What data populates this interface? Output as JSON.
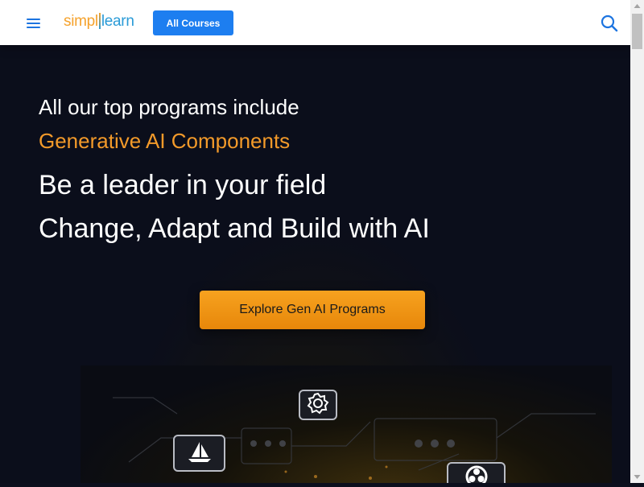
{
  "header": {
    "logo_part1": "simpl",
    "logo_part2": "learn",
    "all_courses_label": "All Courses"
  },
  "hero": {
    "line1": "All our top programs include",
    "line2": "Generative AI Components",
    "line3": "Be a leader in your field",
    "line4": "Change, Adapt and Build with AI",
    "cta_label": "Explore Gen AI Programs"
  },
  "icons": {
    "menu": "hamburger-menu-icon",
    "search": "search-icon",
    "tiles": [
      "gear-icon",
      "sailboat-icon",
      "openai-logo-icon"
    ]
  },
  "colors": {
    "brand_orange": "#f5a22c",
    "brand_blue": "#2a9bd7",
    "button_blue": "#1d7ef0",
    "accent_text": "#f39a2a",
    "cta": "#f39a1a",
    "background": "#0b0e1b"
  }
}
